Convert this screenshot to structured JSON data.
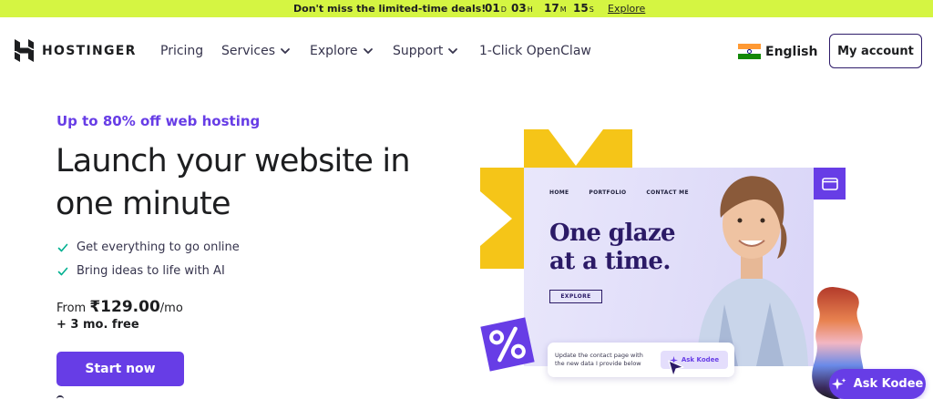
{
  "promo": {
    "message": "Don't miss the limited-time deals!",
    "countdown": [
      {
        "value": "01",
        "unit": "D"
      },
      {
        "value": "03",
        "unit": "H"
      },
      {
        "value": "17",
        "unit": "M"
      },
      {
        "value": "15",
        "unit": "S"
      }
    ],
    "link": "Explore"
  },
  "nav": {
    "brand": "HOSTINGER",
    "items": [
      {
        "label": "Pricing",
        "dropdown": false
      },
      {
        "label": "Services",
        "dropdown": true
      },
      {
        "label": "Explore",
        "dropdown": true
      },
      {
        "label": "Support",
        "dropdown": true
      },
      {
        "label": "1-Click OpenClaw",
        "dropdown": false
      }
    ],
    "language": "English",
    "account": "My account"
  },
  "hero": {
    "kicker": "Up to 80% off web hosting",
    "headline": "Launch your website in one minute",
    "features": [
      "Get everything to go online",
      "Bring ideas to life with AI"
    ],
    "price_prefix": "From ",
    "price": "₹129.00",
    "price_suffix": "/mo",
    "bonus": "+ 3 mo. free",
    "cta": "Start now"
  },
  "illustration": {
    "card_nav": [
      "HOME",
      "PORTFOLIO",
      "CONTACT ME"
    ],
    "card_heading_line1": "One glaze",
    "card_heading_line2": "at a time.",
    "card_button": "EXPLORE",
    "kodee_prompt": "Update the contact page with the new data I provide below",
    "kodee_button": "Ask Kodee"
  },
  "floating": {
    "ask_kodee": "Ask Kodee"
  },
  "colors": {
    "accent": "#673de6",
    "promo_bg": "#d5f542",
    "yellow": "#f5c518"
  }
}
